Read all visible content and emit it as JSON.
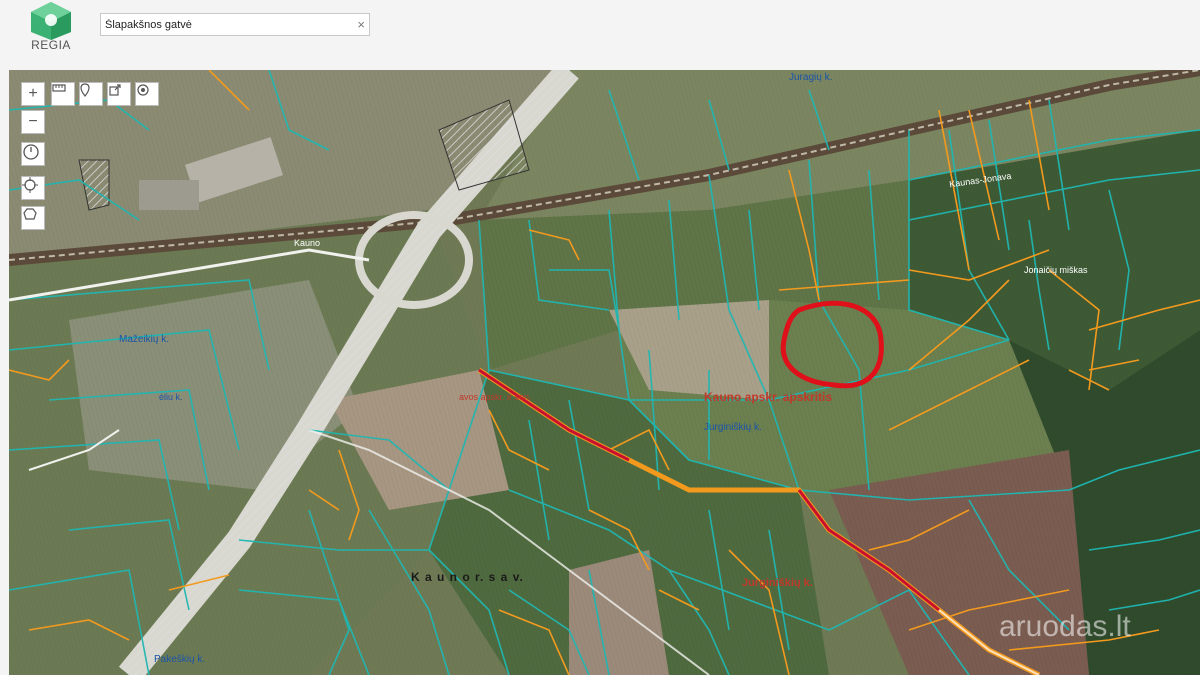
{
  "header": {
    "logo_text": "REGIA",
    "search": {
      "value": "Šlapakšnos gatvė",
      "clear_icon": "×"
    }
  },
  "map_controls": {
    "zoom_in": "+",
    "zoom_out": "−",
    "tools": [
      "ruler-icon",
      "marker-icon",
      "export-icon",
      "circle-target-icon",
      "compass-icon",
      "locate-icon",
      "area-icon"
    ]
  },
  "map_labels": {
    "county": "Kauno apskr. apskritis",
    "municipality": "K a u n o  r.  s a v.",
    "village_jurginiskiu": "Jurginiškių k.",
    "village_jurginiskiu_2": "Jurginiškių k.",
    "village_juragiu": "Juragių k.",
    "village_pakeskiu": "Pakeškių k.",
    "village_mazeikiu": "Mažeikių k.",
    "village_left_small": "ėliu k.",
    "village_sen": "avos apskr. ir sen.",
    "village_right": "Jonaičių miškas",
    "road_top": "Kauno",
    "road_right": "Kaunas-Jonava"
  },
  "watermark": "aruodas.lt",
  "colors": {
    "highlight_circle": "#e0101a",
    "parcel_teal": "#1fb7b2",
    "parcel_orange": "#f39a1e",
    "road_red": "#c8102e"
  }
}
